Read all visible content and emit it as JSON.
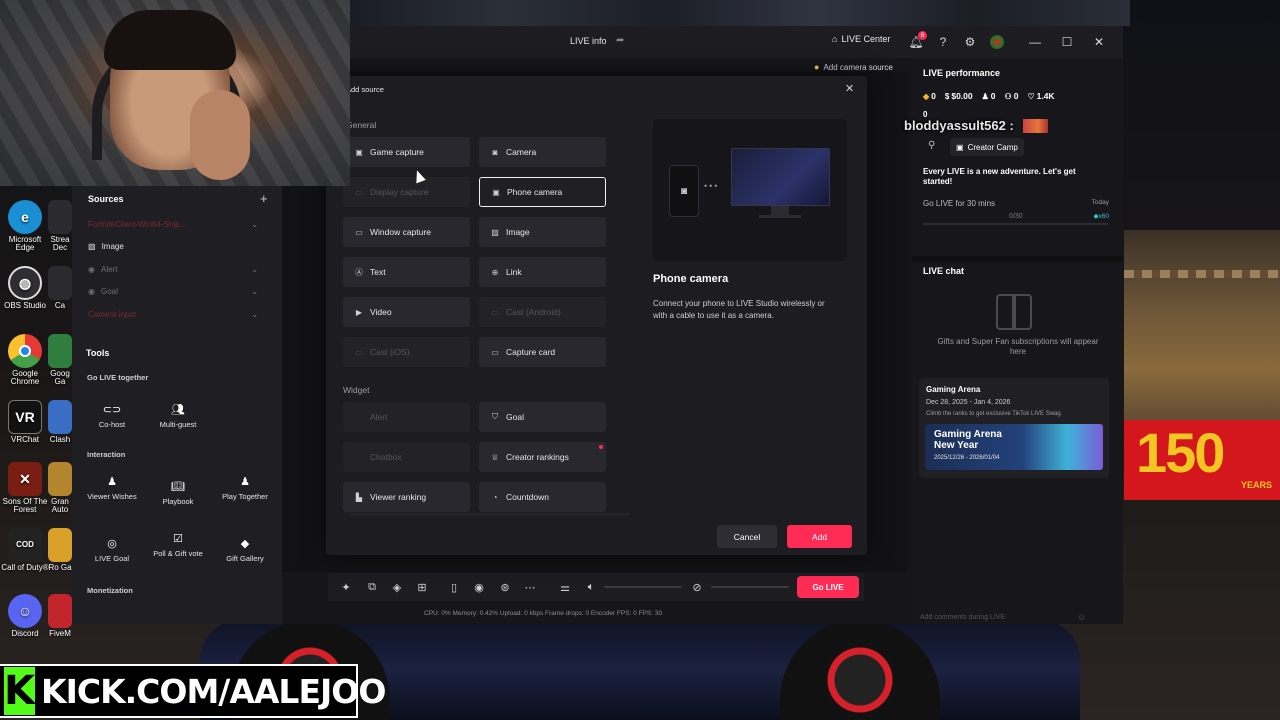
{
  "overlay": {
    "username": "bloddyassult562 :",
    "kick_text": "KICK.COM/AALEJOO",
    "kick_letter": "K"
  },
  "desktop_icons": [
    {
      "label": "Microsoft Edge",
      "icon": "edge-icon",
      "color": "#1b8fd4"
    },
    {
      "label": "OBS Studio",
      "icon": "obs-icon",
      "color": "#3a3a3f"
    },
    {
      "label": "Google Chrome",
      "icon": "chrome-icon",
      "color": "#e53935"
    },
    {
      "label": "VRChat",
      "icon": "vrchat-icon",
      "color": "#1b1b1b"
    },
    {
      "label": "Sons Of The Forest",
      "icon": "sotf-icon",
      "color": "#7a1d12"
    },
    {
      "label": "Call of Duty®",
      "icon": "cod-icon",
      "color": "#222222"
    },
    {
      "label": "Discord",
      "icon": "discord-icon",
      "color": "#5865f2"
    }
  ],
  "desktop_icons_right": [
    {
      "label": "Strea Dec"
    },
    {
      "label": "Ca"
    },
    {
      "label": "Goog Ga"
    },
    {
      "label": "Clash"
    },
    {
      "label": "Gran Auto"
    },
    {
      "label": "Ro Ga"
    },
    {
      "label": "FiveM"
    }
  ],
  "titlebar": {
    "title": "LIVE info",
    "live_center": "LIVE Center",
    "notif_count": "8"
  },
  "tip": {
    "add_camera": "Add camera source"
  },
  "sources": {
    "title": "Sources",
    "items": [
      {
        "label": "FortniteClient-Win64-Ship...",
        "style": "red"
      },
      {
        "label": "Image",
        "style": "active"
      },
      {
        "label": "Alert",
        "style": "dim"
      },
      {
        "label": "Goal",
        "style": "dim"
      },
      {
        "label": "Camera input",
        "style": "red"
      }
    ]
  },
  "tools": {
    "title": "Tools",
    "go_live_together": "Go LIVE together",
    "cohost": "Co-host",
    "multiguest": "Multi-guest",
    "interaction": "Interaction",
    "viewer_wishes": "Viewer Wishes",
    "playbook": "Playbook",
    "play_together": "Play Together",
    "live_goal": "LIVE Goal",
    "poll_gift_vote": "Poll & Gift vote",
    "gift_gallery": "Gift Gallery",
    "monetization": "Monetization"
  },
  "bottombar": {
    "go_live": "Go LIVE",
    "stats": "CPU: 0%     Memory: 0.42%     Upload: 0 kbps     Frame drops: 0     Encoder FPS: 0     FPS: 30"
  },
  "performance": {
    "title": "LIVE performance",
    "diamonds": "0",
    "earnings": "$0.00",
    "viewers": "0",
    "new_followers": "0",
    "likes": "1.4K",
    "extra": "0",
    "creator_camp": "Creator Camp",
    "adventure": "Every LIVE is a new adventure. Let's get started!",
    "task": "Go LIVE for 30 mins",
    "today": "Today",
    "progress_text": "0/30",
    "progress_fraction": 0,
    "reward": "x60"
  },
  "chat": {
    "title": "LIVE chat",
    "empty_text": "Gifts and Super Fan subscriptions will appear here",
    "input_placeholder": "Add comments during LIVE"
  },
  "arena": {
    "title": "Gaming Arena",
    "dates": "Dec 28, 2025 - Jan 4, 2026",
    "subtitle": "Climb the ranks to get exclusive TikTok LIVE Swag",
    "banner_title": "Gaming Arena New Year",
    "banner_dates": "2025/12/26 - 2026/01/04"
  },
  "dialog": {
    "title": "Add source",
    "general_label": "General",
    "widget_label": "Widget",
    "options": {
      "game_capture": "Game capture",
      "camera": "Camera",
      "display_capture": "Display capture",
      "phone_camera": "Phone camera",
      "window_capture": "Window capture",
      "image": "Image",
      "text": "Text",
      "link": "Link",
      "video": "Video",
      "cast_android": "Cast (Android)",
      "cast_ios": "Cast (iOS)",
      "capture_card": "Capture card",
      "alert": "Alert",
      "goal": "Goal",
      "chatbox": "Chatbox",
      "creator_rankings": "Creator rankings",
      "viewer_ranking": "Viewer ranking",
      "countdown": "Countdown"
    },
    "selected_title": "Phone camera",
    "selected_desc": "Connect your phone to LIVE Studio wirelessly or with a cable to use it as a camera.",
    "cancel": "Cancel",
    "add": "Add"
  },
  "scene": {
    "barrier_big": "150",
    "barrier_small": "YEARS",
    "accent": "#fe2c55"
  }
}
